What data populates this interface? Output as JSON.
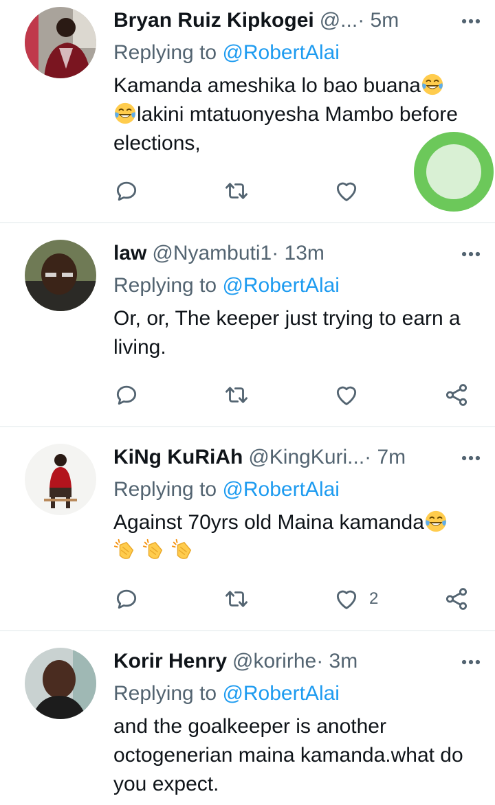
{
  "colors": {
    "link": "#1d9bf0",
    "secondary": "#536471",
    "text": "#0f1419",
    "touch": "#6cc85a"
  },
  "tweets": [
    {
      "name": "Bryan Ruiz Kipkogei",
      "handle": "@...",
      "time": " · 5m",
      "reply_prefix": "Replying to ",
      "reply_to": "@RobertAlai",
      "text_parts": [
        "Kamanda ameshika lo bao buana",
        "lakini mtatuonyesha Mambo before elections,"
      ],
      "like_count": ""
    },
    {
      "name": "law",
      "handle": "@Nyambuti1",
      "time": " · 13m",
      "reply_prefix": "Replying to ",
      "reply_to": "@RobertAlai",
      "text": "Or, or, The keeper just trying to earn a living.",
      "like_count": ""
    },
    {
      "name": "KiNg KuRiAh",
      "handle": "@KingKuri...",
      "time": " · 7m",
      "reply_prefix": "Replying to ",
      "reply_to": "@RobertAlai",
      "text": "Against 70yrs old Maina kamanda",
      "like_count": "2"
    },
    {
      "name": "Korir Henry",
      "handle": "@korirhe",
      "time": " · 3m",
      "reply_prefix": "Replying to ",
      "reply_to": "@RobertAlai",
      "text": "and the goalkeeper is another octogenerian maina kamanda.what do you expect.",
      "like_count": ""
    }
  ],
  "icons": {
    "reply": "reply-icon",
    "retweet": "retweet-icon",
    "like": "heart-icon",
    "share": "share-icon",
    "more": "more-icon",
    "laugh": "tears-of-joy-emoji",
    "clap": "clapping-hands-emoji"
  }
}
